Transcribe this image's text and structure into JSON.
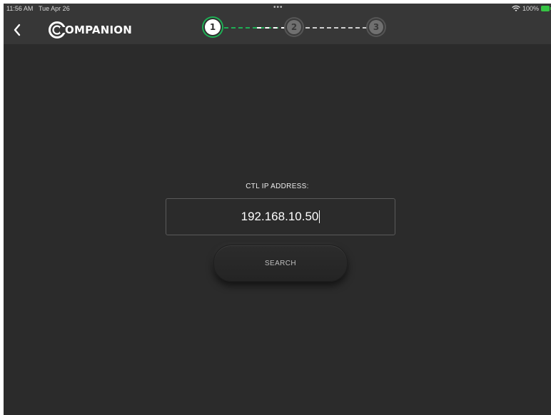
{
  "status_bar": {
    "time": "11:56 AM",
    "date": "Tue Apr 26",
    "more": "•••",
    "battery": "100%"
  },
  "header": {
    "logo_text": "OMPANION",
    "back_icon": "chevron-left-icon"
  },
  "stepper": {
    "steps": [
      "1",
      "2",
      "3"
    ],
    "current_step": 1,
    "active_color": "#1fae55"
  },
  "form": {
    "label": "CTL IP ADDRESS:",
    "ip_value": "192.168.10.50",
    "button_label": "SEARCH"
  }
}
